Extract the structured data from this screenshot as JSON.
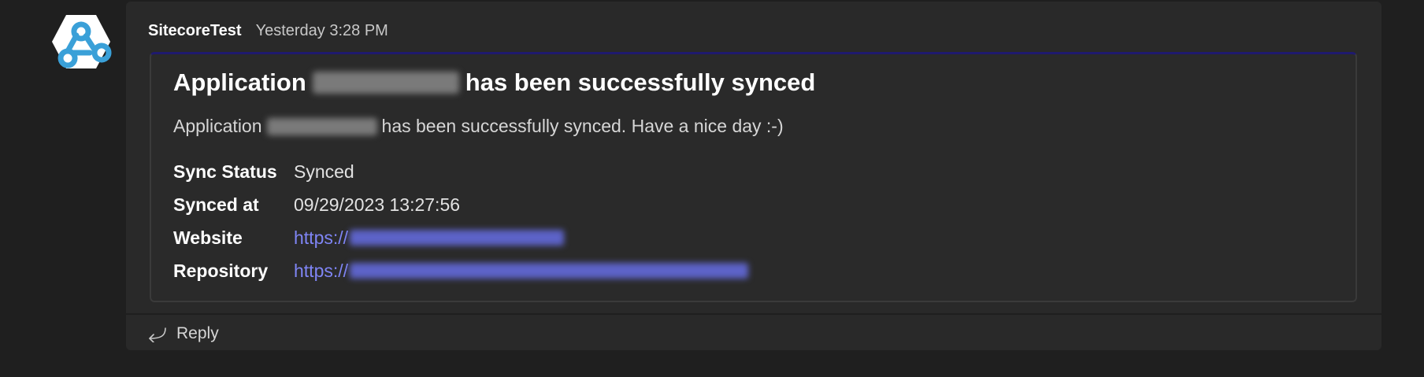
{
  "message": {
    "sender": "SitecoreTest",
    "timestamp": "Yesterday 3:28 PM",
    "avatar_icon": "webhook-icon"
  },
  "card": {
    "title_prefix": "Application",
    "title_suffix": "has been successfully synced",
    "subtitle_prefix": "Application",
    "subtitle_suffix": "has been successfully synced. Have a nice day :-)",
    "facts": [
      {
        "key": "Sync Status",
        "value": "Synced"
      },
      {
        "key": "Synced at",
        "value": "09/29/2023 13:27:56"
      },
      {
        "key": "Website",
        "value": "https://"
      },
      {
        "key": "Repository",
        "value": "https://"
      }
    ],
    "accent_color": "#1f1a6e",
    "link_color": "#7f85f5"
  },
  "actions": {
    "reply_label": "Reply",
    "reply_icon": "reply-arrow-icon"
  }
}
